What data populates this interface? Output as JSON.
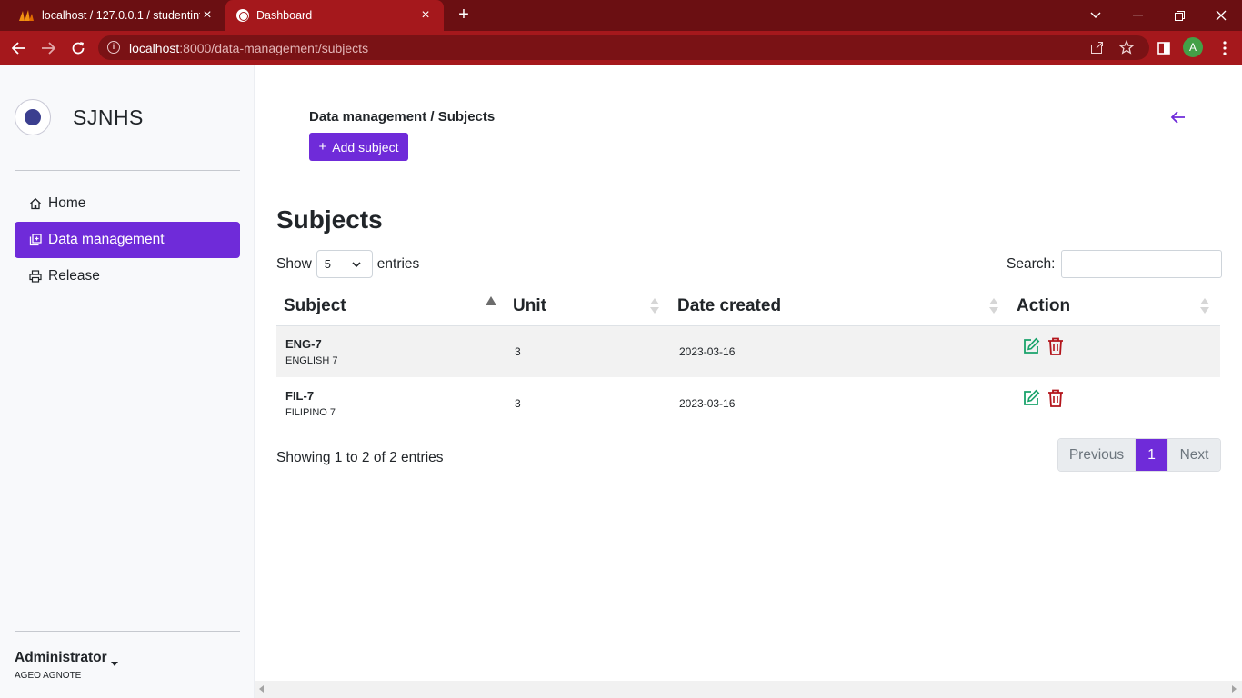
{
  "browser": {
    "tabs": [
      {
        "title": "localhost / 127.0.0.1 / studentinfo",
        "icon": "phpmyadmin-icon",
        "active": false
      },
      {
        "title": "Dashboard",
        "icon": "globe-icon",
        "active": true
      }
    ],
    "url_host": "localhost",
    "url_rest": ":8000/data-management/subjects",
    "profile_initial": "A"
  },
  "sidebar": {
    "brand": "SJNHS",
    "items": [
      {
        "label": "Home",
        "icon": "house-icon"
      },
      {
        "label": "Data management",
        "icon": "stack-icon"
      },
      {
        "label": "Release",
        "icon": "printer-icon"
      }
    ],
    "user_role": "Administrator",
    "user_name": "AGEO AGNOTE"
  },
  "header": {
    "breadcrumb": "Data management / Subjects",
    "add_button": "Add subject"
  },
  "main": {
    "title": "Subjects",
    "show_label": "Show",
    "entries_label": "entries",
    "page_length": "5",
    "search_label": "Search:",
    "search_value": "",
    "columns": [
      "Subject",
      "Unit",
      "Date created",
      "Action"
    ],
    "rows": [
      {
        "code": "ENG-7",
        "name": "ENGLISH 7",
        "unit": "3",
        "date": "2023-03-16"
      },
      {
        "code": "FIL-7",
        "name": "FILIPINO 7",
        "unit": "3",
        "date": "2023-03-16"
      }
    ],
    "info": "Showing 1 to 2 of 2 entries",
    "pagination": {
      "previous": "Previous",
      "current": "1",
      "next": "Next"
    }
  },
  "colors": {
    "accent": "#6f2bd9",
    "edit": "#1aa36b",
    "delete": "#b3141b",
    "chrome": "#a5181c"
  }
}
